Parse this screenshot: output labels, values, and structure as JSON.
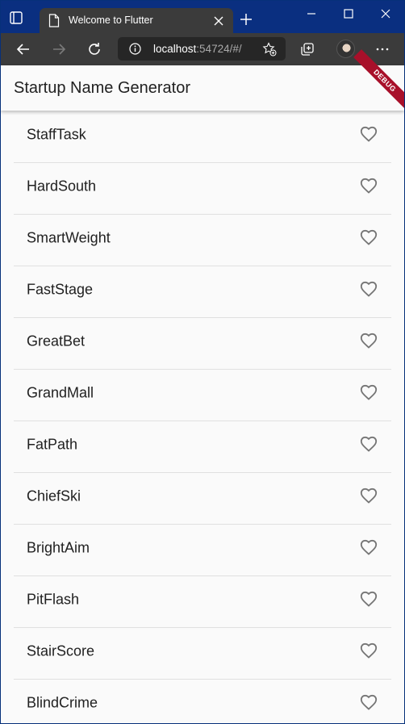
{
  "browser": {
    "tab": {
      "title": "Welcome to Flutter"
    },
    "address": {
      "host": "localhost",
      "rest": ":54724/#/"
    }
  },
  "app": {
    "title": "Startup Name Generator",
    "debug_banner": "DEBUG"
  },
  "list": {
    "items": [
      {
        "label": "StaffTask",
        "favorited": false
      },
      {
        "label": "HardSouth",
        "favorited": false
      },
      {
        "label": "SmartWeight",
        "favorited": false
      },
      {
        "label": "FastStage",
        "favorited": false
      },
      {
        "label": "GreatBet",
        "favorited": false
      },
      {
        "label": "GrandMall",
        "favorited": false
      },
      {
        "label": "FatPath",
        "favorited": false
      },
      {
        "label": "ChiefSki",
        "favorited": false
      },
      {
        "label": "BrightAim",
        "favorited": false
      },
      {
        "label": "PitFlash",
        "favorited": false
      },
      {
        "label": "StairScore",
        "favorited": false
      },
      {
        "label": "BlindCrime",
        "favorited": false
      }
    ]
  },
  "colors": {
    "titlebar": "#0a2f80",
    "toolbar": "#3b3b3b",
    "app_background": "#fafafa",
    "debug_banner": "#a8102a",
    "divider": "#e0e0e0"
  }
}
